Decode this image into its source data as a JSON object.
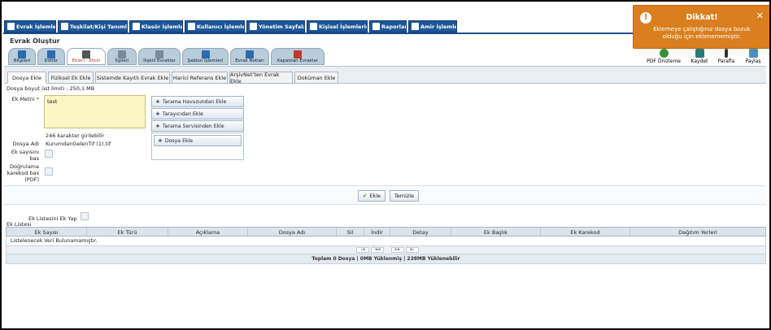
{
  "topnav": [
    {
      "label": "Evrak İşlemleri",
      "icon": "document-icon"
    },
    {
      "label": "Teşkilat/Kişi Tanımları",
      "icon": "org-chart-icon"
    },
    {
      "label": "Klasör İşlemleri",
      "icon": "folder-icon"
    },
    {
      "label": "Kullanıcı İşlemleri",
      "icon": "user-icon"
    },
    {
      "label": "Yönetim Sayfaları",
      "icon": "admin-icon"
    },
    {
      "label": "Kişisel İşlemlerim",
      "icon": "personal-icon"
    },
    {
      "label": "Raporlar",
      "icon": "report-icon"
    },
    {
      "label": "Amir İşlemleri",
      "icon": "manager-icon"
    }
  ],
  "page_title": "Evrak Oluştur",
  "main_tabs": [
    {
      "label": "Bilgileri",
      "icon": "info-icon"
    },
    {
      "label": "Editör",
      "icon": "editor-icon"
    },
    {
      "label": "Ekleri - Etkin",
      "icon": "paperclip-icon"
    },
    {
      "label": "İlgileri",
      "icon": "link-icon"
    },
    {
      "label": "İlişkili Evraklar",
      "icon": "related-docs-icon"
    },
    {
      "label": "Şablon İşlemleri",
      "icon": "template-icon"
    },
    {
      "label": "Evrak Notları",
      "icon": "notes-icon"
    },
    {
      "label": "Kapatılan Evraklar",
      "icon": "closed-docs-icon"
    }
  ],
  "right_tools": [
    {
      "label": "PDF Önizleme",
      "icon": "pdf-preview-icon"
    },
    {
      "label": "Kaydet",
      "icon": "save-icon"
    },
    {
      "label": "Parafla",
      "icon": "pen-icon"
    },
    {
      "label": "Paylaş",
      "icon": "share-icon"
    }
  ],
  "sub_tabs": [
    "Dosya Ekle",
    "Fiziksel Ek Ekle",
    "Sistemde Kayıtlı Evrak Ekle",
    "Harici Referans Ekle",
    "ArşivNet'ten Evrak Ekle",
    "Doküman Ekle"
  ],
  "form": {
    "size_limit": "Dosya boyut üst limiti : 250,1 MB",
    "ek_metni_label": "Ek Metni",
    "required_mark": "*",
    "ek_metni_value": "test",
    "char_count": "246 karakter girilebilir",
    "dosya_adi_label": "Dosya Adı",
    "dosya_adi_value": "KurumdanGelenTif (1).tif",
    "ek_sayisi_label": "Ek sayısını bas",
    "dogrulama_label": "Doğrulama karekod bas (PDF)",
    "scan_pool": "Tarama Havuzundan Ekle",
    "scanner": "Tarayıcıdan Ekle",
    "scan_service": "Tarama Servisinden Ekle",
    "add_file": "Dosya Ekle",
    "plus": "+",
    "save_btn": "Ekle",
    "clear_btn": "Temizle",
    "ek_listesi_ek_yap": "Ek Listesini Ek Yap"
  },
  "table": {
    "title": "Ek Listesi",
    "columns": [
      "Ek Sayısı",
      "Ek Türü",
      "Açıklama",
      "Dosya Adı",
      "Sil",
      "İndir",
      "Detay",
      "Ek Başlık",
      "Ek Karekod",
      "Dağıtım Yerleri"
    ],
    "empty_text": "Listelenecek Veri Bulunamamıştır.",
    "pager": [
      "|◀",
      "◀◀",
      "▶▶",
      "▶|"
    ],
    "footer": "Toplam 0 Dosya | 0MB Yüklenmiş | 238MB Yüklenebilir"
  },
  "toast": {
    "title": "Dikkat!",
    "icon_glyph": "!",
    "close_glyph": "✕",
    "message": "Eklemeye çalıştığınız dosya bozuk olduğu için eklenememiştir."
  },
  "colors": {
    "nav": "#1e5799",
    "toast": "#d97f1e",
    "textarea": "#fbf6c3"
  }
}
